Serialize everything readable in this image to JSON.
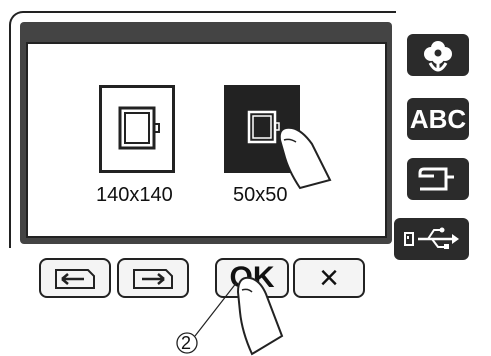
{
  "hoops": [
    {
      "label": "140x140",
      "selected": false
    },
    {
      "label": "50x50",
      "selected": true
    }
  ],
  "buttons": {
    "ok_label": "OK",
    "cancel_label": "×",
    "prev_icon": "page-left-icon",
    "next_icon": "page-right-icon"
  },
  "side_tabs": [
    {
      "icon": "flower-icon"
    },
    {
      "label": "ABC"
    },
    {
      "icon": "sewing-machine-icon"
    },
    {
      "icon": "usb-icon"
    }
  ],
  "callout_label": "2"
}
